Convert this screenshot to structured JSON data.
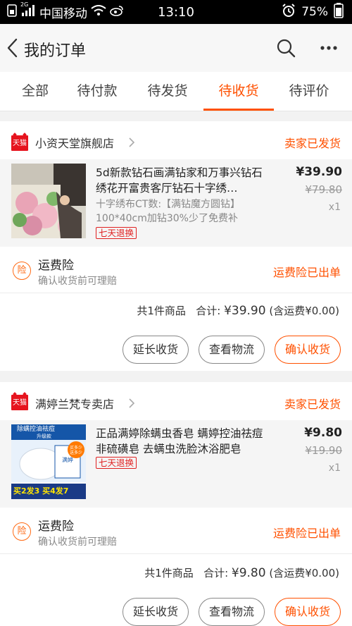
{
  "status_bar": {
    "carrier": "中国移动",
    "signal_prefix": "2G",
    "time": "13:10",
    "battery": "75%"
  },
  "nav": {
    "title": "我的订单",
    "icons": [
      "back-icon",
      "search-icon",
      "more-icon"
    ]
  },
  "tabs": [
    {
      "label": "全部"
    },
    {
      "label": "待付款"
    },
    {
      "label": "待发货"
    },
    {
      "label": "待收货"
    },
    {
      "label": "待评价"
    }
  ],
  "active_tab": "待收货",
  "orders": [
    {
      "shop_badge": "天猫",
      "shop": "小资天堂旗舰店",
      "status": "卖家已发货",
      "item": {
        "title": "5d新款钻石画满钻家和万事兴钻石绣花开富贵客厅钻石十字绣…",
        "sku": "十字绣布CT数:【满钻魔方圆钻】100*40cm加钻30%少了免费补",
        "tag": "七天退换",
        "price": "¥39.90",
        "original_price": "¥79.80",
        "qty": "x1"
      },
      "insurance": {
        "icon": "险",
        "title": "运费险",
        "subtitle": "确认收货前可理赔",
        "status": "运费险已出单"
      },
      "summary": {
        "count": "共1件商品",
        "total_label": "合计: ",
        "total": "¥39.90",
        "shipping": "(含运费¥0.00)"
      },
      "buttons": [
        "延长收货",
        "查看物流",
        "确认收货"
      ]
    },
    {
      "shop_badge": "天猫",
      "shop": "满婷兰梵专卖店",
      "status": "卖家已发货",
      "item": {
        "title": "正品满婷除螨虫香皂 螨婷控油祛痘非硫磺皂 去螨虫洗脸沐浴肥皂",
        "tag": "七天退换",
        "price": "¥9.80",
        "original_price": "¥19.90",
        "qty": "x1",
        "thumb_text": {
          "top": "除螨控油祛痘",
          "upgrade": "升级款",
          "brand": "满婷",
          "promo_badge": "买多少送多少",
          "bottom": "买2发3 买4发7"
        }
      },
      "insurance": {
        "icon": "险",
        "title": "运费险",
        "subtitle": "确认收货前可理赔",
        "status": "运费险已出单"
      },
      "summary": {
        "count": "共1件商品",
        "total_label": "合计: ",
        "total": "¥9.80",
        "shipping": "(含运费¥0.00)"
      },
      "buttons": [
        "延长收货",
        "查看物流",
        "确认收货"
      ]
    }
  ],
  "colors": {
    "accent": "#ff5000",
    "tmall_red": "#e6141e",
    "background": "#f2f2f2"
  }
}
